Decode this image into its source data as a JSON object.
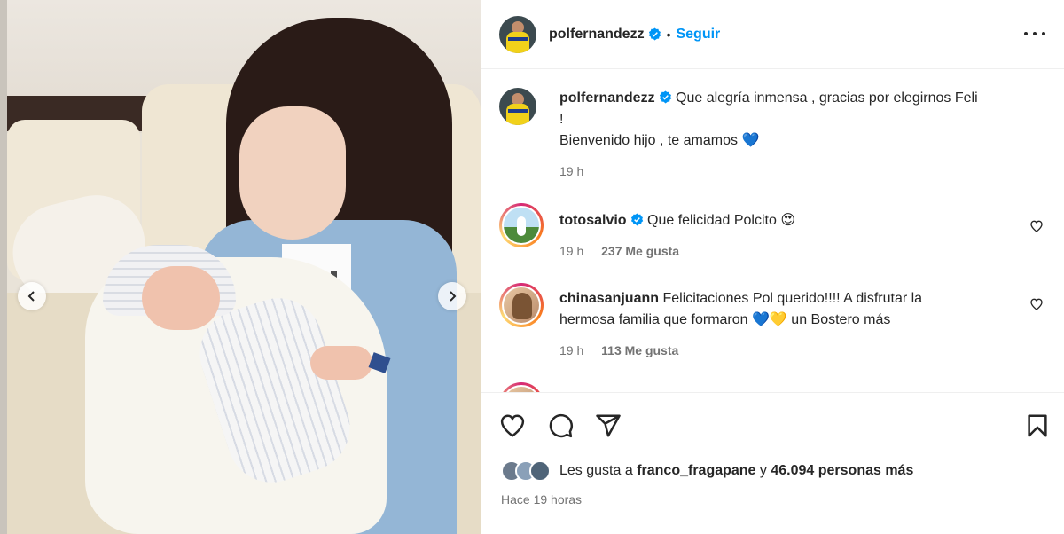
{
  "post": {
    "author": "polfernandezz",
    "follow_label": "Seguir",
    "separator": "•"
  },
  "caption": {
    "username": "polfernandezz",
    "line1": "Que alegría inmensa , gracias por elegirnos Feli",
    "line2": "!",
    "line3": "Bienvenido hijo , te amamos",
    "emoji": "💙",
    "time": "19 h"
  },
  "comments": [
    {
      "username": "totosalvio",
      "text": "Que felicidad Polcito",
      "emoji": "😍",
      "time": "19 h",
      "likes": "237 Me gusta"
    },
    {
      "username": "chinasanjuann",
      "text_line1": "Felicitaciones Pol querido!!!! A disfrutar la",
      "text_line2a": "hermosa familia que formaron",
      "emojis": "💙💛",
      "text_line2b": "un Bostero más",
      "time": "19 h",
      "likes": "113 Me gusta"
    }
  ],
  "likes_summary": {
    "prefix": "Les gusta a",
    "user": "franco_fragapane",
    "middle": "y",
    "count_text": "46.094 personas más"
  },
  "timestamp": "Hace 19 horas",
  "icons": {
    "verified": "verified-badge-icon",
    "more": "more-options-icon",
    "like": "heart-icon",
    "comment": "comment-icon",
    "share": "paper-plane-icon",
    "save": "bookmark-icon",
    "prev": "chevron-left-icon",
    "next": "chevron-right-icon"
  },
  "colors": {
    "accent": "#0095f6",
    "text": "#262626",
    "secondary": "#737373"
  }
}
